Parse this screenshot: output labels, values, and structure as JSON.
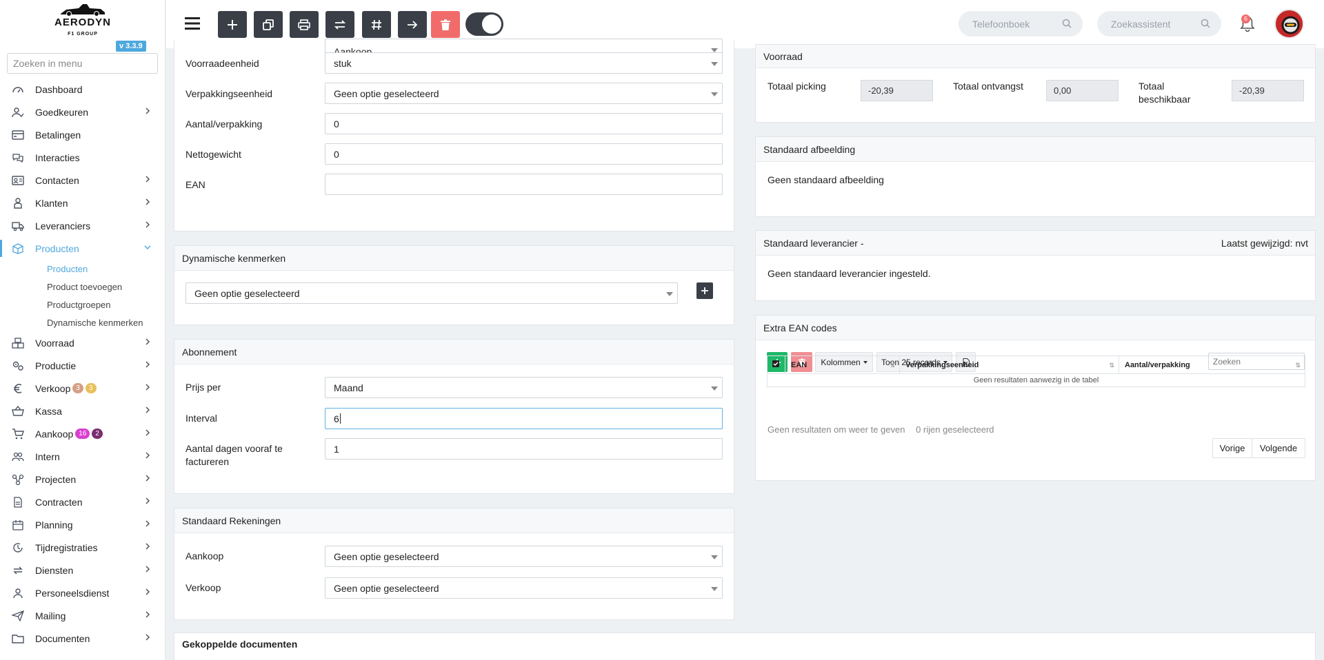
{
  "brand": {
    "name": "AERODYN",
    "sub": "F1 GROUP",
    "version": "v 3.3.9"
  },
  "menu_search": {
    "placeholder": "Zoeken in menu"
  },
  "nav": [
    {
      "label": "Dashboard",
      "icon": "dashboard-icon"
    },
    {
      "label": "Goedkeuren",
      "icon": "user-check-icon",
      "chevron": true
    },
    {
      "label": "Betalingen",
      "icon": "credit-card-icon"
    },
    {
      "label": "Interacties",
      "icon": "chat-icon"
    },
    {
      "label": "Contacten",
      "icon": "contact-card-icon",
      "chevron": true
    },
    {
      "label": "Klanten",
      "icon": "customer-icon",
      "chevron": true
    },
    {
      "label": "Leveranciers",
      "icon": "truck-icon",
      "chevron": true
    },
    {
      "label": "Producten",
      "icon": "box-icon",
      "chevron": true,
      "active": true
    }
  ],
  "nav_sub": [
    {
      "label": "Producten",
      "active": true
    },
    {
      "label": "Product toevoegen"
    },
    {
      "label": "Productgroepen"
    },
    {
      "label": "Dynamische kenmerken"
    }
  ],
  "nav2": [
    {
      "label": "Voorraad",
      "icon": "boxes-icon"
    },
    {
      "label": "Productie",
      "icon": "gears-icon"
    },
    {
      "label": "Verkoop",
      "icon": "euro-icon",
      "badges": [
        {
          "text": "3",
          "color": "#d4a085"
        },
        {
          "text": "3",
          "color": "#e8c05a"
        }
      ]
    },
    {
      "label": "Kassa",
      "icon": "basket-icon"
    },
    {
      "label": "Aankoop",
      "icon": "cart-icon",
      "badges": [
        {
          "text": "16",
          "color": "#d93fd0"
        },
        {
          "text": "2",
          "color": "#7b2d6e"
        }
      ]
    },
    {
      "label": "Intern",
      "icon": "people-icon"
    },
    {
      "label": "Projecten",
      "icon": "project-icon"
    },
    {
      "label": "Contracten",
      "icon": "contract-icon"
    },
    {
      "label": "Planning",
      "icon": "calendar-icon"
    },
    {
      "label": "Tijdregistraties",
      "icon": "clock-icon"
    },
    {
      "label": "Diensten",
      "icon": "refresh-icon"
    },
    {
      "label": "Personeelsdienst",
      "icon": "person-icon"
    },
    {
      "label": "Mailing",
      "icon": "send-icon"
    },
    {
      "label": "Documenten",
      "icon": "folder-icon"
    }
  ],
  "topbar": {
    "phonebook_placeholder": "Telefoonboek",
    "assistant_placeholder": "Zoekassistent",
    "notifications": "6"
  },
  "form_top": {
    "partial_value": "Aankoop",
    "fields": [
      {
        "label": "Voorraadeenheid",
        "value": "stuk",
        "type": "select"
      },
      {
        "label": "Verpakkingseenheid",
        "value": "Geen optie geselecteerd",
        "type": "select"
      },
      {
        "label": "Aantal/verpakking",
        "value": "0",
        "type": "text"
      },
      {
        "label": "Nettogewicht",
        "value": "0",
        "type": "text"
      },
      {
        "label": "EAN",
        "value": "",
        "type": "text"
      }
    ]
  },
  "dyn": {
    "title": "Dynamische kenmerken",
    "select": "Geen optie geselecteerd"
  },
  "abonnement": {
    "title": "Abonnement",
    "prijs_label": "Prijs per",
    "prijs_value": "Maand",
    "interval_label": "Interval",
    "interval_value": "6",
    "dagen_label": "Aantal dagen vooraf te factureren",
    "dagen_value": "1"
  },
  "rekeningen": {
    "title": "Standaard Rekeningen",
    "aankoop_label": "Aankoop",
    "aankoop_value": "Geen optie geselecteerd",
    "verkoop_label": "Verkoop",
    "verkoop_value": "Geen optie geselecteerd"
  },
  "docs": {
    "title": "Gekoppelde documenten"
  },
  "voorraad": {
    "title": "Voorraad",
    "picking_label": "Totaal picking",
    "picking_value": "-20,39",
    "ontvangst_label": "Totaal ontvangst",
    "ontvangst_value": "0,00",
    "beschikbaar_label": "Totaal beschikbaar",
    "beschikbaar_value": "-20,39"
  },
  "afbeelding": {
    "title": "Standaard afbeelding",
    "text": "Geen standaard afbeelding"
  },
  "leverancier": {
    "title": "Standaard leverancier -",
    "right": "Laatst gewijzigd: nvt",
    "text": "Geen standaard leverancier ingesteld."
  },
  "extra_ean": {
    "title": "Extra EAN codes",
    "kolommen": "Kolommen",
    "toon": "Toon 25 records",
    "search_placeholder": "Zoeken",
    "columns": [
      "EAN",
      "Verpakkingseenheid",
      "Aantal/verpakking"
    ],
    "empty": "Geen resultaten aanwezig in de tabel",
    "footer_info": "Geen resultaten om weer te geven",
    "selected": "0 rijen geselecteerd",
    "prev": "Vorige",
    "next": "Volgende"
  }
}
